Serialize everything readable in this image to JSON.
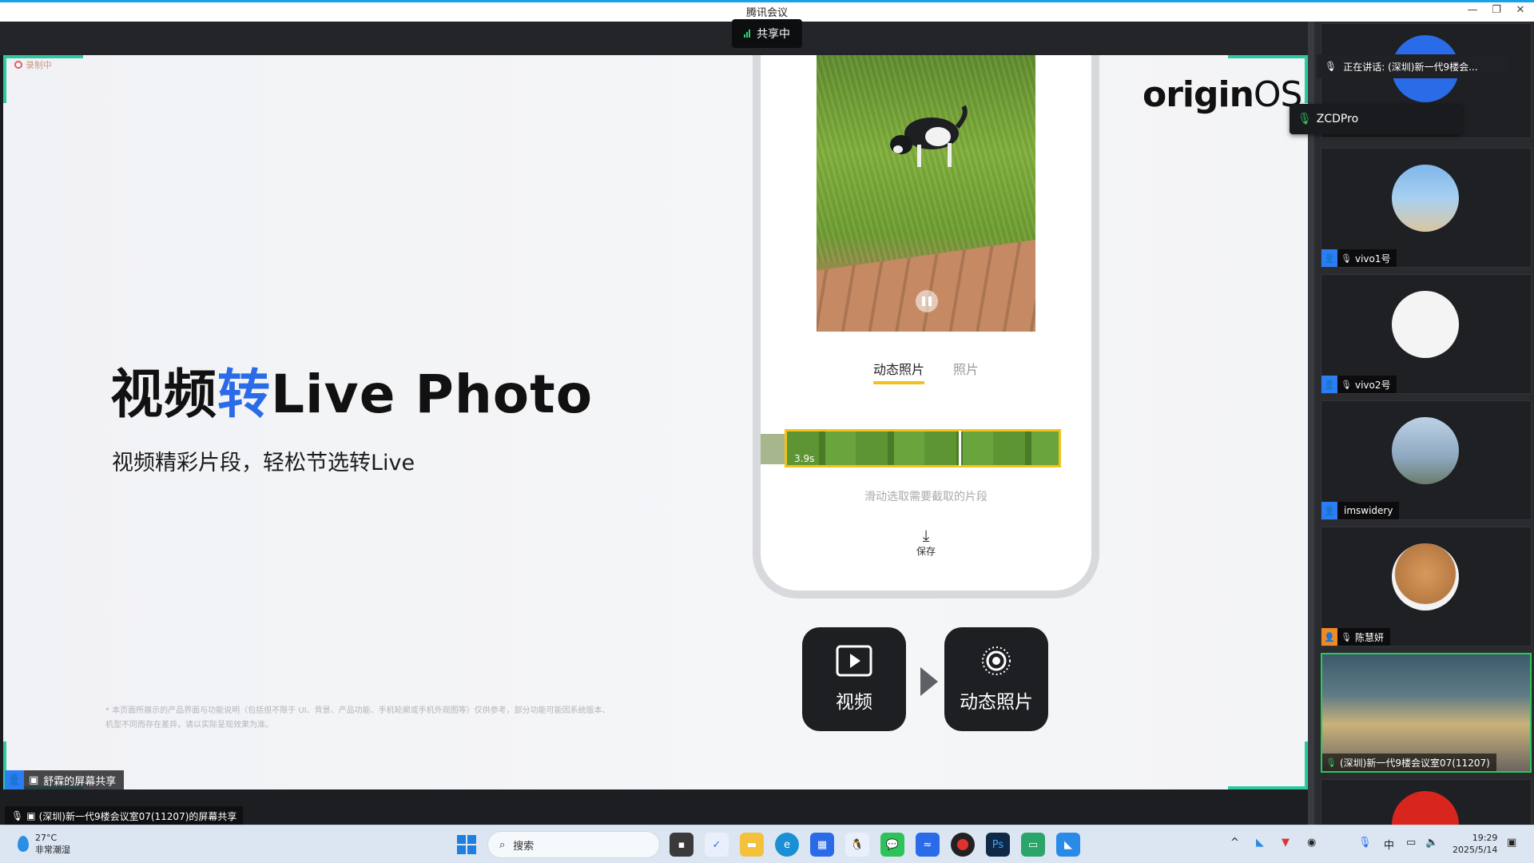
{
  "window": {
    "title": "腾讯会议",
    "controls": [
      "—",
      "❐",
      "✕"
    ]
  },
  "share_indicator": {
    "label": "共享中"
  },
  "slide": {
    "recording_badge": "录制中",
    "title_part1": "视频",
    "title_accent": "转",
    "title_part2": "Live Photo",
    "subtitle": "视频精彩片段，轻松节选转Live",
    "disclaimer": "* 本页面所展示的产品界面与功能说明（包括但不限于 UI、背景、产品功能、手机轮廓或手机外观图等）仅供参考，部分功能可能因系统版本、机型不同而存在差异，请以实际呈现效果为准。",
    "logo_origin": "origin",
    "logo_os": "OS",
    "phone": {
      "tab_active": "动态照片",
      "tab_other": "照片",
      "duration": "3.9s",
      "hint": "滑动选取需要截取的片段",
      "save_label": "保存"
    },
    "feature_video": "视频",
    "feature_live": "动态照片"
  },
  "sharer_tag": "舒霖的屏幕共享",
  "bottom_label": "(深圳)新一代9楼会议室07(11207)的屏幕共享",
  "sidebar": {
    "speaking_label": "正在讲话: (深圳)新一代9楼会...",
    "popup_name": "ZCDPro",
    "participants": [
      {
        "name": "vivo1号"
      },
      {
        "name": "vivo2号"
      },
      {
        "name": "imswidery"
      },
      {
        "name": "陈慧妍"
      },
      {
        "name": "(深圳)新一代9楼会议室07(11207)"
      }
    ]
  },
  "taskbar": {
    "weather_temp": "27°C",
    "weather_desc": "非常潮湿",
    "search_placeholder": "搜索",
    "ime": "中",
    "time": "19:29",
    "date": "2025/5/14"
  },
  "colors": {
    "accent": "#2a6be8",
    "highlight": "#f2c21b",
    "share_border": "#2cc8a0"
  }
}
